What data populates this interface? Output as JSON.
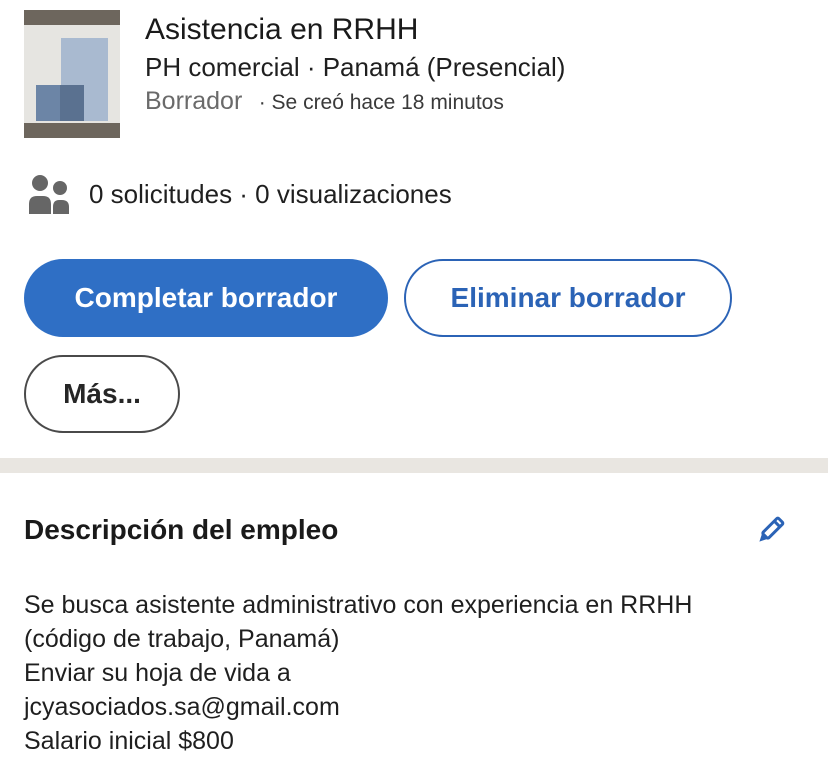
{
  "job": {
    "title": "Asistencia en RRHH",
    "subtitle": "PH comercial · Panamá (Presencial)",
    "status": "Borrador",
    "created": "· Se creó hace 18 minutos",
    "logo_icon": "company-logo-icon"
  },
  "stats": {
    "icon": "people-icon",
    "text": "0 solicitudes · 0 visualizaciones"
  },
  "actions": {
    "complete_label": "Completar borrador",
    "delete_label": "Eliminar borrador",
    "more_label": "Más..."
  },
  "description": {
    "title": "Descripción del empleo",
    "edit_icon": "pencil-icon",
    "lines": [
      "Se busca asistente administrativo con experiencia en RRHH",
      "(código de trabajo, Panamá)",
      "Enviar su hoja de vida a",
      "jcyasociados.sa@gmail.com",
      "Salario inicial $800"
    ]
  },
  "colors": {
    "primary": "#2f6fc5",
    "primary_border": "#2b63b6",
    "divider": "#e9e6e1",
    "muted_text": "#6a6a6a"
  }
}
